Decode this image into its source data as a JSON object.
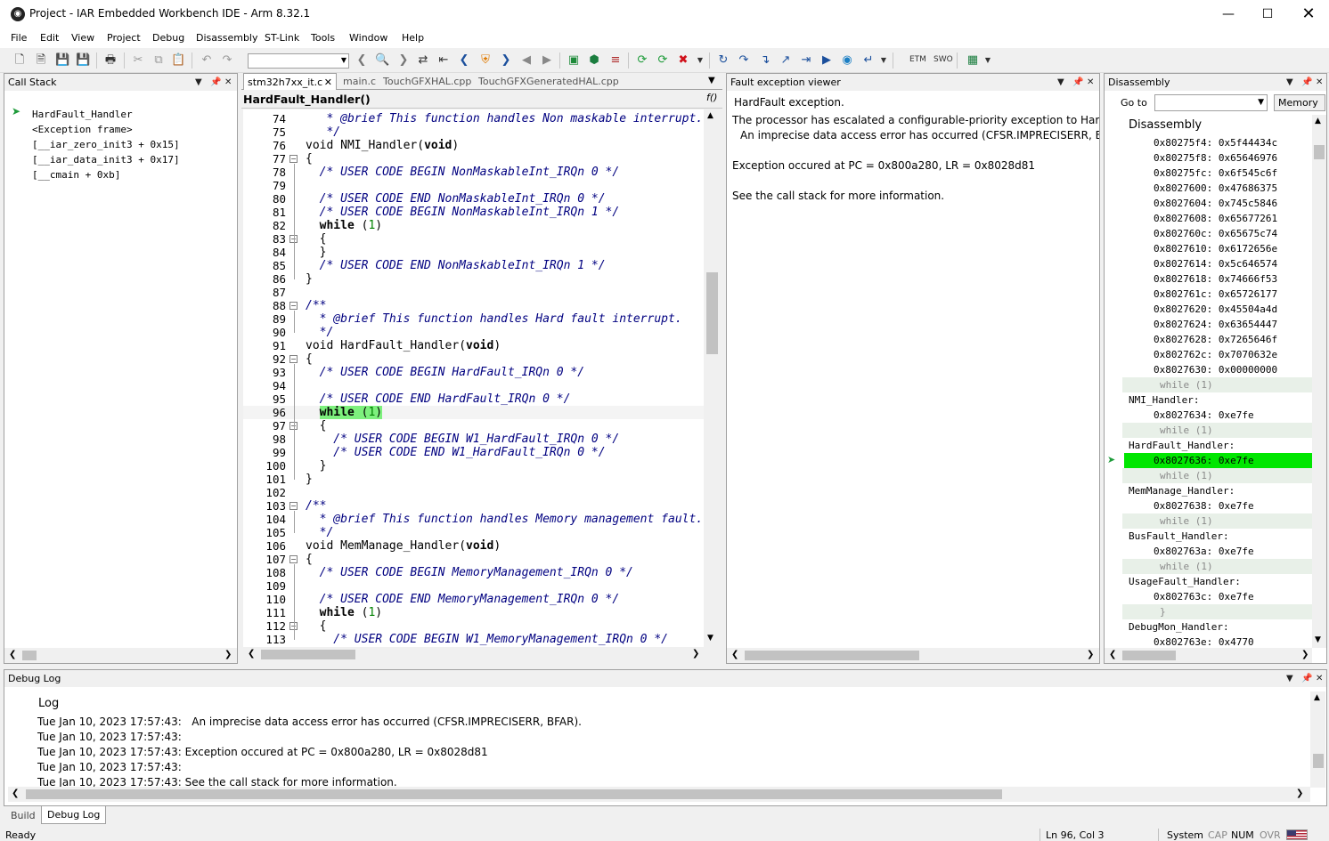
{
  "window": {
    "title": "Project - IAR Embedded Workbench IDE - Arm 8.32.1"
  },
  "menu": [
    "File",
    "Edit",
    "View",
    "Project",
    "Debug",
    "Disassembly",
    "ST-Link",
    "Tools",
    "Window",
    "Help"
  ],
  "toolbar": {
    "etm_label": "ETM",
    "swo_label": "SWO"
  },
  "callstack": {
    "title": "Call Stack",
    "items": [
      "HardFault_Handler",
      "<Exception frame>",
      "[__iar_zero_init3 + 0x15]",
      "[__iar_data_init3 + 0x17]",
      "[__cmain + 0xb]"
    ]
  },
  "editor": {
    "tabs": [
      "stm32h7xx_it.c",
      "main.c",
      "TouchGFXHAL.cpp",
      "TouchGFXGeneratedHAL.cpp"
    ],
    "function": "HardFault_Handler()",
    "func_icon": "f()",
    "lines": [
      {
        "n": "74",
        "segs": [
          {
            "t": "   * @brief This function handles Non maskable interrupt.",
            "c": "cm"
          }
        ]
      },
      {
        "n": "75",
        "segs": [
          {
            "t": "   */",
            "c": "cm"
          }
        ]
      },
      {
        "n": "76",
        "segs": [
          {
            "t": "void ",
            "c": ""
          },
          {
            "t": "NMI_Handler(",
            "c": ""
          },
          {
            "t": "void",
            "c": "kw"
          },
          {
            "t": ")",
            "c": ""
          }
        ]
      },
      {
        "n": "77",
        "segs": [
          {
            "t": "{",
            "c": ""
          }
        ]
      },
      {
        "n": "78",
        "segs": [
          {
            "t": "  /* USER CODE BEGIN NonMaskableInt_IRQn 0 */",
            "c": "cm"
          }
        ]
      },
      {
        "n": "79",
        "segs": []
      },
      {
        "n": "80",
        "segs": [
          {
            "t": "  /* USER CODE END NonMaskableInt_IRQn 0 */",
            "c": "cm"
          }
        ]
      },
      {
        "n": "81",
        "segs": [
          {
            "t": "  /* USER CODE BEGIN NonMaskableInt_IRQn 1 */",
            "c": "cm"
          }
        ]
      },
      {
        "n": "82",
        "segs": [
          {
            "t": "  ",
            "c": ""
          },
          {
            "t": "while",
            "c": "kw"
          },
          {
            "t": " (",
            "c": ""
          },
          {
            "t": "1",
            "c": "num"
          },
          {
            "t": ")",
            "c": ""
          }
        ]
      },
      {
        "n": "83",
        "segs": [
          {
            "t": "  {",
            "c": ""
          }
        ]
      },
      {
        "n": "84",
        "segs": [
          {
            "t": "  }",
            "c": ""
          }
        ]
      },
      {
        "n": "85",
        "segs": [
          {
            "t": "  /* USER CODE END NonMaskableInt_IRQn 1 */",
            "c": "cm"
          }
        ]
      },
      {
        "n": "86",
        "segs": [
          {
            "t": "}",
            "c": ""
          }
        ]
      },
      {
        "n": "87",
        "segs": []
      },
      {
        "n": "88",
        "segs": [
          {
            "t": "/**",
            "c": "cm"
          }
        ]
      },
      {
        "n": "89",
        "segs": [
          {
            "t": "  * @brief This function handles Hard fault interrupt.",
            "c": "cm"
          }
        ]
      },
      {
        "n": "90",
        "segs": [
          {
            "t": "  */",
            "c": "cm"
          }
        ]
      },
      {
        "n": "91",
        "segs": [
          {
            "t": "void ",
            "c": ""
          },
          {
            "t": "HardFault_Handler(",
            "c": ""
          },
          {
            "t": "void",
            "c": "kw"
          },
          {
            "t": ")",
            "c": ""
          }
        ]
      },
      {
        "n": "92",
        "segs": [
          {
            "t": "{",
            "c": ""
          }
        ]
      },
      {
        "n": "93",
        "segs": [
          {
            "t": "  /* USER CODE BEGIN HardFault_IRQn 0 */",
            "c": "cm"
          }
        ]
      },
      {
        "n": "94",
        "segs": []
      },
      {
        "n": "95",
        "segs": [
          {
            "t": "  /* USER CODE END HardFault_IRQn 0 */",
            "c": "cm"
          }
        ]
      },
      {
        "n": "96",
        "segs": [
          {
            "t": "  ",
            "c": ""
          },
          {
            "t": "while",
            "c": "kw"
          },
          {
            "t": " (",
            "c": ""
          },
          {
            "t": "1",
            "c": "num"
          },
          {
            "t": ")",
            "c": ""
          }
        ]
      },
      {
        "n": "97",
        "segs": [
          {
            "t": "  {",
            "c": ""
          }
        ]
      },
      {
        "n": "98",
        "segs": [
          {
            "t": "    /* USER CODE BEGIN W1_HardFault_IRQn 0 */",
            "c": "cm"
          }
        ]
      },
      {
        "n": "99",
        "segs": [
          {
            "t": "    /* USER CODE END W1_HardFault_IRQn 0 */",
            "c": "cm"
          }
        ]
      },
      {
        "n": "100",
        "segs": [
          {
            "t": "  }",
            "c": ""
          }
        ]
      },
      {
        "n": "101",
        "segs": [
          {
            "t": "}",
            "c": ""
          }
        ]
      },
      {
        "n": "102",
        "segs": []
      },
      {
        "n": "103",
        "segs": [
          {
            "t": "/**",
            "c": "cm"
          }
        ]
      },
      {
        "n": "104",
        "segs": [
          {
            "t": "  * @brief This function handles Memory management fault.",
            "c": "cm"
          }
        ]
      },
      {
        "n": "105",
        "segs": [
          {
            "t": "  */",
            "c": "cm"
          }
        ]
      },
      {
        "n": "106",
        "segs": [
          {
            "t": "void ",
            "c": ""
          },
          {
            "t": "MemManage_Handler(",
            "c": ""
          },
          {
            "t": "void",
            "c": "kw"
          },
          {
            "t": ")",
            "c": ""
          }
        ]
      },
      {
        "n": "107",
        "segs": [
          {
            "t": "{",
            "c": ""
          }
        ]
      },
      {
        "n": "108",
        "segs": [
          {
            "t": "  /* USER CODE BEGIN MemoryManagement_IRQn 0 */",
            "c": "cm"
          }
        ]
      },
      {
        "n": "109",
        "segs": []
      },
      {
        "n": "110",
        "segs": [
          {
            "t": "  /* USER CODE END MemoryManagement_IRQn 0 */",
            "c": "cm"
          }
        ]
      },
      {
        "n": "111",
        "segs": [
          {
            "t": "  ",
            "c": ""
          },
          {
            "t": "while",
            "c": "kw"
          },
          {
            "t": " (",
            "c": ""
          },
          {
            "t": "1",
            "c": "num"
          },
          {
            "t": ")",
            "c": ""
          }
        ]
      },
      {
        "n": "112",
        "segs": [
          {
            "t": "  {",
            "c": ""
          }
        ]
      },
      {
        "n": "113",
        "segs": [
          {
            "t": "    /* USER CODE BEGIN W1_MemoryManagement_IRQn 0 */",
            "c": "cm"
          }
        ]
      }
    ]
  },
  "fault": {
    "title": "Fault exception viewer",
    "heading": "HardFault exception.",
    "line1": "The processor has escalated a configurable-priority exception to HardFault.",
    "line2": "An imprecise data access error has occurred (CFSR.IMPRECISERR, BFAR).",
    "line3": "Exception occured at PC = 0x800a280, LR = 0x8028d81",
    "line4": "See the call stack for more information."
  },
  "disasm": {
    "title": "Disassembly",
    "goto_label": "Go to",
    "memory_button": "Memory",
    "header": "Disassembly",
    "rows": [
      {
        "k": "addr",
        "t": "0x80275f4: 0x5f44434c"
      },
      {
        "k": "addr",
        "t": "0x80275f8: 0x65646976"
      },
      {
        "k": "addr",
        "t": "0x80275fc: 0x6f545c6f"
      },
      {
        "k": "addr",
        "t": "0x8027600: 0x47686375"
      },
      {
        "k": "addr",
        "t": "0x8027604: 0x745c5846"
      },
      {
        "k": "addr",
        "t": "0x8027608: 0x65677261"
      },
      {
        "k": "addr",
        "t": "0x802760c: 0x65675c74"
      },
      {
        "k": "addr",
        "t": "0x8027610: 0x6172656e"
      },
      {
        "k": "addr",
        "t": "0x8027614: 0x5c646574"
      },
      {
        "k": "addr",
        "t": "0x8027618: 0x74666f53"
      },
      {
        "k": "addr",
        "t": "0x802761c: 0x65726177"
      },
      {
        "k": "addr",
        "t": "0x8027620: 0x45504a4d"
      },
      {
        "k": "addr",
        "t": "0x8027624: 0x63654447"
      },
      {
        "k": "addr",
        "t": "0x8027628: 0x7265646f"
      },
      {
        "k": "addr",
        "t": "0x802762c: 0x7070632e"
      },
      {
        "k": "addr",
        "t": "0x8027630: 0x00000000"
      },
      {
        "k": "src",
        "t": "while (1)"
      },
      {
        "k": "label",
        "t": "NMI_Handler:"
      },
      {
        "k": "addr",
        "t": "0x8027634: 0xe7fe"
      },
      {
        "k": "src",
        "t": "while (1)"
      },
      {
        "k": "label",
        "t": "HardFault_Handler:"
      },
      {
        "k": "cur",
        "t": "0x8027636: 0xe7fe"
      },
      {
        "k": "src",
        "t": "while (1)"
      },
      {
        "k": "label",
        "t": "MemManage_Handler:"
      },
      {
        "k": "addr",
        "t": "0x8027638: 0xe7fe"
      },
      {
        "k": "src",
        "t": "while (1)"
      },
      {
        "k": "label",
        "t": "BusFault_Handler:"
      },
      {
        "k": "addr",
        "t": "0x802763a: 0xe7fe"
      },
      {
        "k": "src",
        "t": "while (1)"
      },
      {
        "k": "label",
        "t": "UsageFault_Handler:"
      },
      {
        "k": "addr",
        "t": "0x802763c: 0xe7fe"
      },
      {
        "k": "src",
        "t": "}"
      },
      {
        "k": "label",
        "t": "DebugMon_Handler:"
      },
      {
        "k": "addr",
        "t": "0x802763e: 0x4770"
      }
    ]
  },
  "debuglog": {
    "title": "Debug Log",
    "header": "Log",
    "lines": [
      "Tue Jan 10, 2023 17:57:43:   An imprecise data access error has occurred (CFSR.IMPRECISERR, BFAR).",
      "Tue Jan 10, 2023 17:57:43:",
      "Tue Jan 10, 2023 17:57:43: Exception occured at PC = 0x800a280, LR = 0x8028d81",
      "Tue Jan 10, 2023 17:57:43:",
      "Tue Jan 10, 2023 17:57:43: See the call stack for more information."
    ]
  },
  "bottom_tabs": [
    "Build",
    "Debug Log"
  ],
  "status": {
    "ready": "Ready",
    "position": "Ln 96, Col 3",
    "system": "System",
    "cap": "CAP",
    "num": "NUM",
    "ovr": "OVR"
  }
}
